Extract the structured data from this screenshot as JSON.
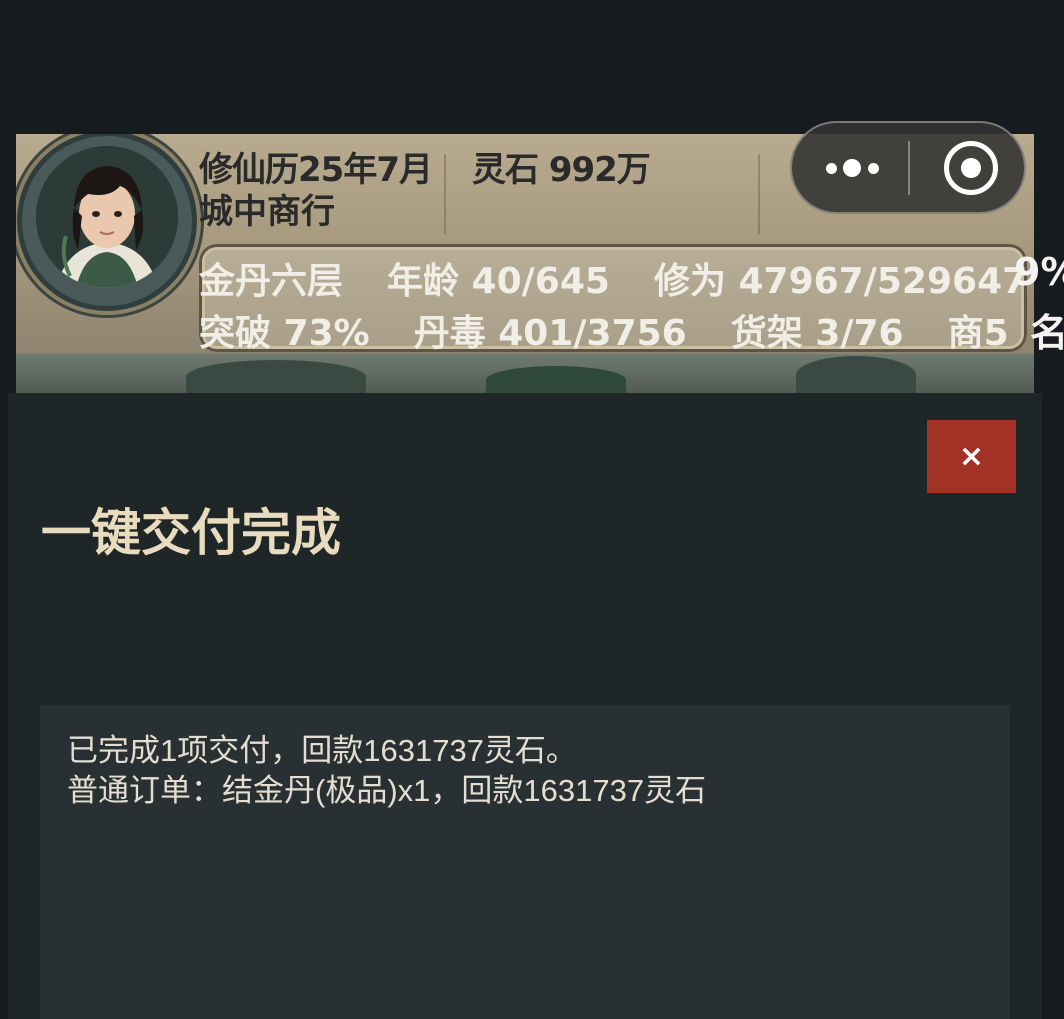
{
  "header": {
    "date": "修仙历25年7月",
    "spirit_stones": "灵石 992万",
    "location": "城中商行",
    "stats_row1": {
      "realm": "金丹六层",
      "age": "年龄 40/645",
      "cultivation": "修为 47967/529647"
    },
    "stats_row1_overflow": "9%",
    "stats_row2": {
      "breakthrough": "突破 73%",
      "pill_toxicity": "丹毒 401/3756",
      "shelf": "货架 3/76",
      "merchant": "商5"
    },
    "stats_row2_overflow": "名"
  },
  "capsule": {
    "more_icon": "more-dots-icon",
    "close_icon": "target-circle-icon"
  },
  "dialog": {
    "close_label": "×",
    "title": "一键交付完成",
    "message_lines": [
      "已完成1项交付，回款1631737灵石。",
      "普通订单：结金丹(极品)x1，回款1631737灵石"
    ]
  },
  "colors": {
    "background": "#161b20",
    "dialog_bg": "#1f2628",
    "message_bg": "#293033",
    "close_button": "#a33226",
    "title_color": "#e9dcbe"
  }
}
